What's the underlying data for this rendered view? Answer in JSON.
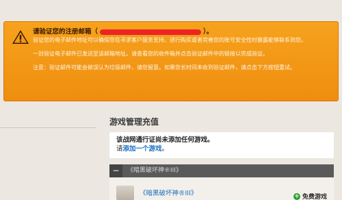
{
  "alert": {
    "title_prefix": "请验证您的注册邮箱（",
    "title_suffix": "）。",
    "para1": "验证您的电子邮件地址可以确保您在寻求客户服务支持、进行购买或者完善您的账号安全性时暴露能够联系到您。",
    "para2": "一封验证电子邮件已发送至该邮箱地址。请查看您的收件箱并点击验证邮件中的链接以完成验证。",
    "para3": "注意：验证邮件可能会被误认为垃圾邮件，请您留意。如果您长时间未收到验证邮件，请点击下方按钮重试。",
    "icon": "warning-icon",
    "colors": {
      "background": "#f29a18",
      "mask": "#ec2424"
    }
  },
  "section": {
    "title": "游戏管理充值"
  },
  "notice": {
    "line1": "该战网通行证尚未添加任何游戏。",
    "line2_prefix": "请",
    "line2_link": "添加一个游戏",
    "line2_suffix": "。"
  },
  "game_group": {
    "header": "《暗黑破坏神®III》",
    "collapse_symbol": "−",
    "item_title": "《暗黑破坏神®III》",
    "free_label": "免费游戏"
  }
}
